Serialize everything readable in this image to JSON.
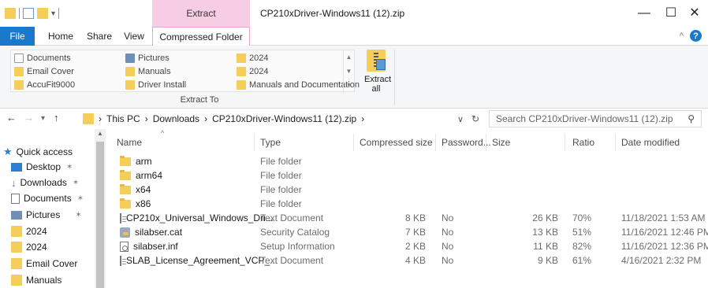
{
  "window": {
    "title": "CP210xDriver-Windows11 (12).zip",
    "contextual_header": "Extract",
    "buttons": {
      "minimize": "—",
      "maximize": "☐",
      "close": "✕"
    }
  },
  "ribbon_tabs": {
    "file": "File",
    "home": "Home",
    "share": "Share",
    "view": "View",
    "compressed": "Compressed Folder Tools"
  },
  "ribbon": {
    "gallery": {
      "col1": [
        "Documents",
        "Email Cover",
        "AccuFit9000"
      ],
      "col2": [
        "Pictures",
        "Manuals",
        "Driver Install"
      ],
      "col3": [
        "2024",
        "2024",
        "Manuals and Documentation"
      ]
    },
    "extract_all": [
      "Extract",
      "all"
    ],
    "group_label": "Extract To"
  },
  "address": {
    "crumbs": [
      "This PC",
      "Downloads",
      "CP210xDriver-Windows11 (12).zip"
    ],
    "search_placeholder": "Search CP210xDriver-Windows11 (12).zip"
  },
  "nav_pane": {
    "quick_access": "Quick access",
    "items": [
      "Desktop",
      "Downloads",
      "Documents",
      "Pictures",
      "2024",
      "2024",
      "Email Cover",
      "Manuals"
    ]
  },
  "columns": {
    "name": "Name",
    "type": "Type",
    "compressed_size": "Compressed size",
    "password": "Password...",
    "size": "Size",
    "ratio": "Ratio",
    "date_modified": "Date modified"
  },
  "files": [
    {
      "name": "arm",
      "type": "File folder",
      "compressed_size": "",
      "password": "",
      "size": "",
      "ratio": "",
      "date": ""
    },
    {
      "name": "arm64",
      "type": "File folder",
      "compressed_size": "",
      "password": "",
      "size": "",
      "ratio": "",
      "date": ""
    },
    {
      "name": "x64",
      "type": "File folder",
      "compressed_size": "",
      "password": "",
      "size": "",
      "ratio": "",
      "date": ""
    },
    {
      "name": "x86",
      "type": "File folder",
      "compressed_size": "",
      "password": "",
      "size": "",
      "ratio": "",
      "date": ""
    },
    {
      "name": "CP210x_Universal_Windows_Dri...",
      "type": "Text Document",
      "compressed_size": "8 KB",
      "password": "No",
      "size": "26 KB",
      "ratio": "70%",
      "date": "11/18/2021 1:53 AM"
    },
    {
      "name": "silabser.cat",
      "type": "Security Catalog",
      "compressed_size": "7 KB",
      "password": "No",
      "size": "13 KB",
      "ratio": "51%",
      "date": "11/16/2021 12:46 PM"
    },
    {
      "name": "silabser.inf",
      "type": "Setup Information",
      "compressed_size": "2 KB",
      "password": "No",
      "size": "11 KB",
      "ratio": "82%",
      "date": "11/16/2021 12:36 PM"
    },
    {
      "name": "SLAB_License_Agreement_VCP_...",
      "type": "Text Document",
      "compressed_size": "4 KB",
      "password": "No",
      "size": "9 KB",
      "ratio": "61%",
      "date": "4/16/2021 2:32 PM"
    }
  ],
  "colors": {
    "file_tab": "#1979ca",
    "contextual": "#f7cde4",
    "folder": "#f5cd5a",
    "help": "#1979ca"
  }
}
